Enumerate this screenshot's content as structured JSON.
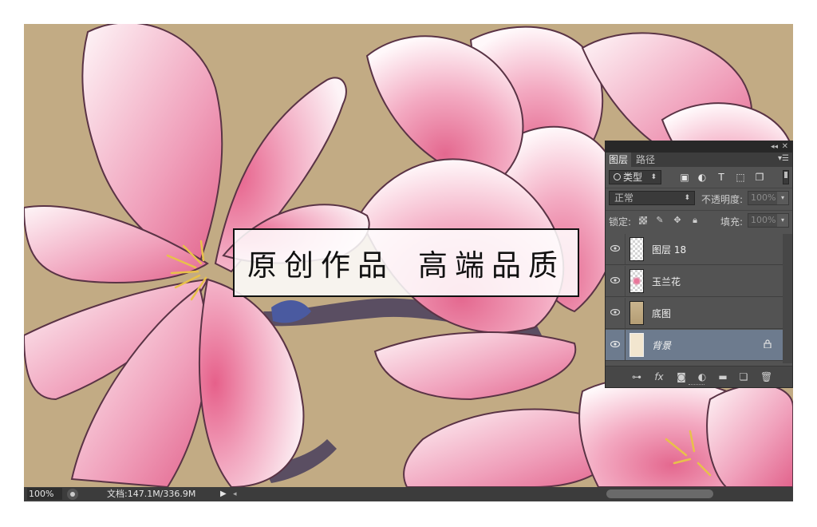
{
  "banner": {
    "part1": "原创作品",
    "part2": "高端品质"
  },
  "status_bar": {
    "zoom": "100%",
    "doc_info": "文档:147.1M/336.9M"
  },
  "layers_panel": {
    "tabs": [
      {
        "label": "图层",
        "active": true
      },
      {
        "label": "路径",
        "active": false
      }
    ],
    "filter_kind": "类型",
    "blend_mode": "正常",
    "opacity_label": "不透明度:",
    "opacity_value": "100%",
    "lock_label": "锁定:",
    "fill_label": "填充:",
    "fill_value": "100%",
    "layers": [
      {
        "name": "图层 18",
        "thumb": "trans",
        "visible": true,
        "selected": false,
        "locked": false
      },
      {
        "name": "玉兰花",
        "thumb": "flower",
        "visible": true,
        "selected": false,
        "locked": false
      },
      {
        "name": "底图",
        "thumb": "base",
        "visible": true,
        "selected": false,
        "locked": false
      },
      {
        "name": "背景",
        "thumb": "bg",
        "visible": true,
        "selected": true,
        "locked": true
      }
    ],
    "colors": {
      "panel_bg": "#535353",
      "selected_layer": "#6d7b8e"
    }
  },
  "canvas": {
    "background_color": "#c2ab84",
    "petal_color": "#e9799c"
  }
}
